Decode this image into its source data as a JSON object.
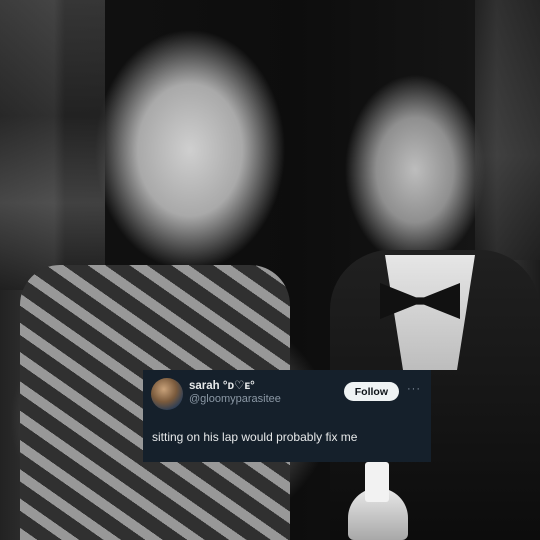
{
  "tweet": {
    "display_name": "sarah °ᴅ♡ᴇ°",
    "handle": "@gloomyparasitee",
    "follow_label": "Follow",
    "more_label": "···",
    "text": "sitting on his lap would probably fix me"
  },
  "background": {
    "description_icon": "photo-background"
  }
}
